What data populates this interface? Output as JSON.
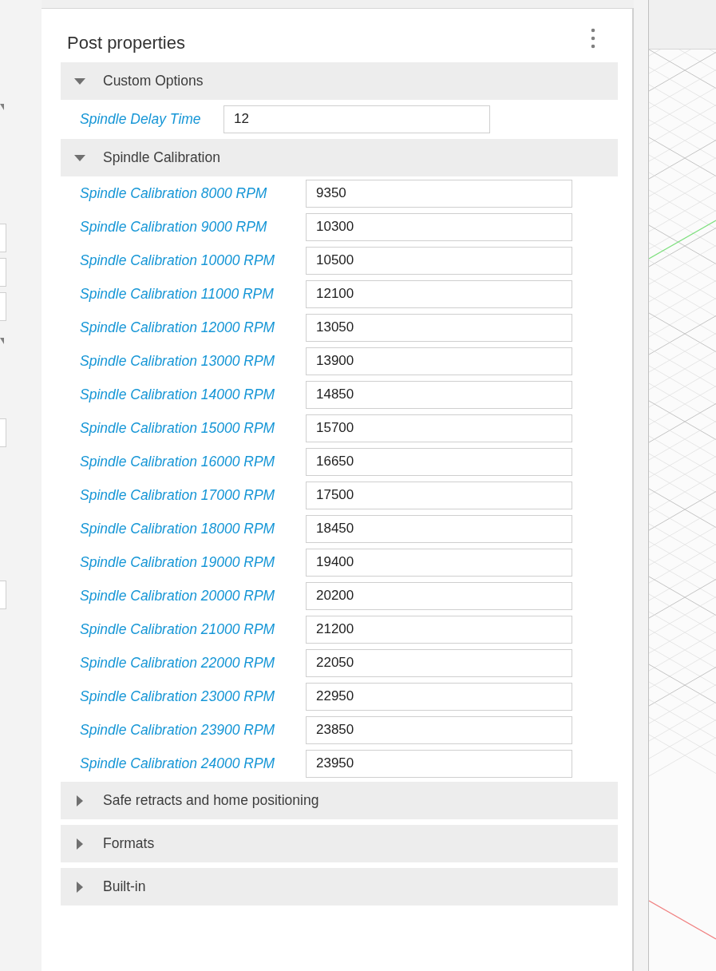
{
  "panel": {
    "title": "Post properties"
  },
  "sections": [
    {
      "title": "Custom Options",
      "expanded": true,
      "fields": [
        {
          "label": "Spindle Delay Time",
          "value": "12"
        }
      ]
    },
    {
      "title": "Spindle Calibration",
      "expanded": true,
      "fields": [
        {
          "label": "Spindle Calibration 8000 RPM",
          "value": "9350"
        },
        {
          "label": "Spindle Calibration 9000 RPM",
          "value": "10300"
        },
        {
          "label": "Spindle Calibration 10000 RPM",
          "value": "10500"
        },
        {
          "label": "Spindle Calibration 11000 RPM",
          "value": "12100"
        },
        {
          "label": "Spindle Calibration 12000 RPM",
          "value": "13050"
        },
        {
          "label": "Spindle Calibration 13000 RPM",
          "value": "13900"
        },
        {
          "label": "Spindle Calibration 14000 RPM",
          "value": "14850"
        },
        {
          "label": "Spindle Calibration 15000 RPM",
          "value": "15700"
        },
        {
          "label": "Spindle Calibration 16000 RPM",
          "value": "16650"
        },
        {
          "label": "Spindle Calibration 17000 RPM",
          "value": "17500"
        },
        {
          "label": "Spindle Calibration 18000 RPM",
          "value": "18450"
        },
        {
          "label": "Spindle Calibration 19000 RPM",
          "value": "19400"
        },
        {
          "label": "Spindle Calibration 20000 RPM",
          "value": "20200"
        },
        {
          "label": "Spindle Calibration 21000 RPM",
          "value": "21200"
        },
        {
          "label": "Spindle Calibration 22000 RPM",
          "value": "22050"
        },
        {
          "label": "Spindle Calibration 23000 RPM",
          "value": "22950"
        },
        {
          "label": "Spindle Calibration 23900 RPM",
          "value": "23850"
        },
        {
          "label": "Spindle Calibration 24000 RPM",
          "value": "23950"
        }
      ]
    },
    {
      "title": "Safe retracts and home positioning",
      "expanded": false
    },
    {
      "title": "Formats",
      "expanded": false
    },
    {
      "title": "Built-in",
      "expanded": false
    }
  ]
}
